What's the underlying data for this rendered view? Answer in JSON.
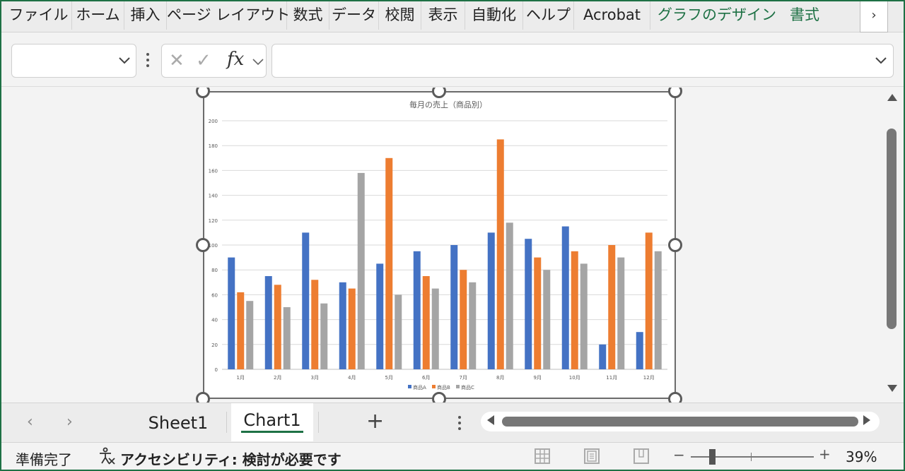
{
  "ribbon": {
    "tabs": [
      "ファイル",
      "ホーム",
      "挿入",
      "ページ レイアウト",
      "数式",
      "データ",
      "校閲",
      "表示",
      "自動化",
      "ヘルプ",
      "Acrobat"
    ],
    "context_tabs": [
      "グラフのデザイン",
      "書式"
    ],
    "more_icon": "chevron-right-icon",
    "more_glyph": "›"
  },
  "formula_bar": {
    "name_box_value": "",
    "cancel_glyph": "✕",
    "enter_glyph": "✓",
    "fx_label": "fx",
    "formula_value": ""
  },
  "chart_data": {
    "type": "bar",
    "title": "毎月の売上（商品別）",
    "categories": [
      "1月",
      "2月",
      "3月",
      "4月",
      "5月",
      "6月",
      "7月",
      "8月",
      "9月",
      "10月",
      "11月",
      "12月"
    ],
    "series": [
      {
        "name": "商品A",
        "color": "#4472c4",
        "values": [
          90,
          75,
          110,
          70,
          85,
          95,
          100,
          110,
          105,
          115,
          20,
          30
        ]
      },
      {
        "name": "商品B",
        "color": "#ed7d31",
        "values": [
          62,
          68,
          72,
          65,
          170,
          75,
          80,
          185,
          90,
          95,
          100,
          110
        ]
      },
      {
        "name": "商品C",
        "color": "#a5a5a5",
        "values": [
          55,
          50,
          53,
          158,
          60,
          65,
          70,
          118,
          80,
          85,
          90,
          95
        ]
      }
    ],
    "ylim": [
      0,
      200
    ],
    "yticks": [
      0,
      20,
      40,
      60,
      80,
      100,
      120,
      140,
      160,
      180,
      200
    ],
    "grid": true,
    "legend": "bottom"
  },
  "sheets": {
    "tabs": [
      "Sheet1",
      "Chart1"
    ],
    "active": "Chart1",
    "add_glyph": "+",
    "prev_glyph": "‹",
    "next_glyph": "›"
  },
  "status": {
    "ready": "準備完了",
    "accessibility": "アクセシビリティ: 検討が必要です",
    "zoom": "39%",
    "zoom_minus": "−",
    "zoom_plus": "+"
  }
}
